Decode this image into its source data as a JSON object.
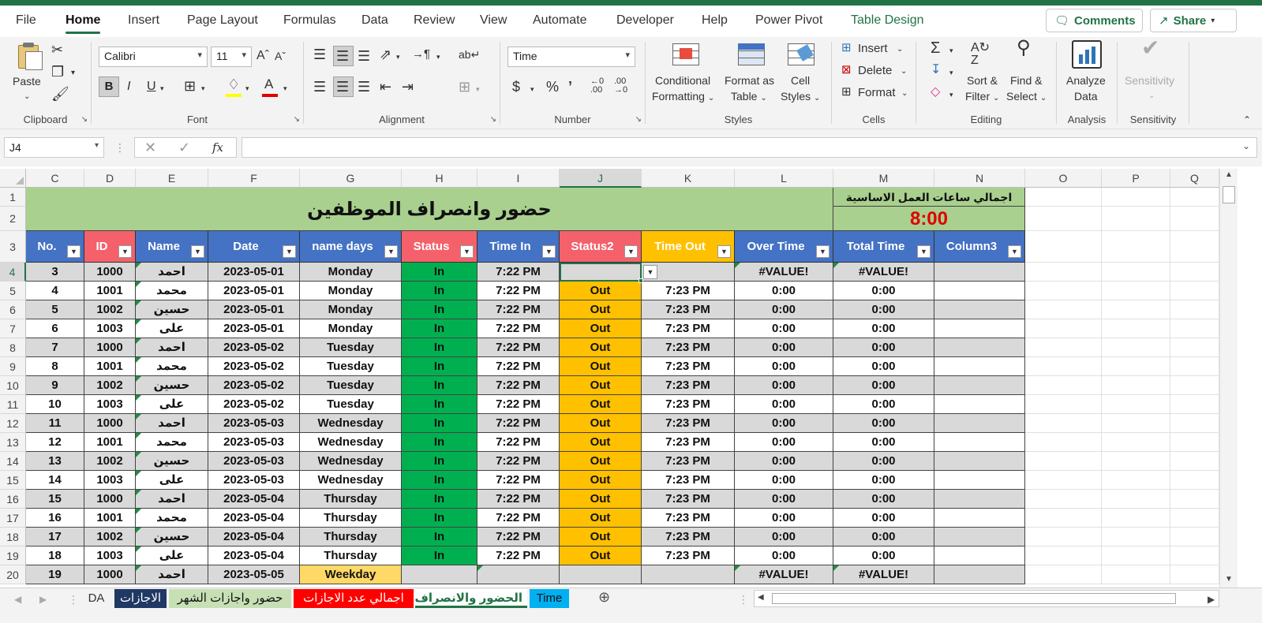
{
  "menu": {
    "tabs": [
      "File",
      "Home",
      "Insert",
      "Page Layout",
      "Formulas",
      "Data",
      "Review",
      "View",
      "Automate",
      "Developer",
      "Help",
      "Power Pivot",
      "Table Design"
    ],
    "comments": "Comments",
    "share": "Share"
  },
  "ribbon": {
    "clipboard": {
      "label": "Clipboard",
      "paste": "Paste"
    },
    "font": {
      "label": "Font",
      "name": "Calibri",
      "size": "11"
    },
    "alignment": {
      "label": "Alignment"
    },
    "number": {
      "label": "Number",
      "format": "Time"
    },
    "styles": {
      "label": "Styles",
      "conditional_1": "Conditional",
      "conditional_2": "Formatting",
      "format_table_1": "Format as",
      "format_table_2": "Table",
      "cell_styles_1": "Cell",
      "cell_styles_2": "Styles"
    },
    "cells": {
      "label": "Cells",
      "insert": "Insert",
      "delete": "Delete",
      "format": "Format"
    },
    "editing": {
      "label": "Editing",
      "sort_1": "Sort &",
      "sort_2": "Filter",
      "find_1": "Find &",
      "find_2": "Select"
    },
    "analysis": {
      "label": "Analysis",
      "analyze_1": "Analyze",
      "analyze_2": "Data"
    },
    "sensitivity": {
      "label": "Sensitivity",
      "btn": "Sensitivity"
    }
  },
  "formula_bar": {
    "name_box": "J4",
    "fx": "fx",
    "value": ""
  },
  "columns": [
    "C",
    "D",
    "E",
    "F",
    "G",
    "H",
    "I",
    "J",
    "K",
    "L",
    "M",
    "N",
    "O",
    "P",
    "Q"
  ],
  "rows": [
    "1",
    "2",
    "3",
    "4",
    "5",
    "6",
    "7",
    "8",
    "9",
    "10",
    "11",
    "12",
    "13",
    "14",
    "15",
    "16",
    "17",
    "18",
    "19",
    "20"
  ],
  "sheet": {
    "title": "حضور وانصراف الموظفين",
    "base_hours_label": "اجمالي ساعات العمل الاساسية",
    "base_hours_value": "8:00",
    "headers": [
      "No.",
      "ID",
      "Name",
      "Date",
      "name days",
      "Status",
      "Time In",
      "Status2",
      "Time Out",
      "Over Time",
      "Total Time",
      "Column3"
    ],
    "data": [
      [
        "3",
        "1000",
        "احمد",
        "2023-05-01",
        "Monday",
        "In",
        "7:22 PM",
        "",
        "",
        "#VALUE!",
        "#VALUE!",
        ""
      ],
      [
        "4",
        "1001",
        "محمد",
        "2023-05-01",
        "Monday",
        "In",
        "7:22 PM",
        "Out",
        "7:23 PM",
        "0:00",
        "0:00",
        ""
      ],
      [
        "5",
        "1002",
        "حسين",
        "2023-05-01",
        "Monday",
        "In",
        "7:22 PM",
        "Out",
        "7:23 PM",
        "0:00",
        "0:00",
        ""
      ],
      [
        "6",
        "1003",
        "على",
        "2023-05-01",
        "Monday",
        "In",
        "7:22 PM",
        "Out",
        "7:23 PM",
        "0:00",
        "0:00",
        ""
      ],
      [
        "7",
        "1000",
        "احمد",
        "2023-05-02",
        "Tuesday",
        "In",
        "7:22 PM",
        "Out",
        "7:23 PM",
        "0:00",
        "0:00",
        ""
      ],
      [
        "8",
        "1001",
        "محمد",
        "2023-05-02",
        "Tuesday",
        "In",
        "7:22 PM",
        "Out",
        "7:23 PM",
        "0:00",
        "0:00",
        ""
      ],
      [
        "9",
        "1002",
        "حسين",
        "2023-05-02",
        "Tuesday",
        "In",
        "7:22 PM",
        "Out",
        "7:23 PM",
        "0:00",
        "0:00",
        ""
      ],
      [
        "10",
        "1003",
        "على",
        "2023-05-02",
        "Tuesday",
        "In",
        "7:22 PM",
        "Out",
        "7:23 PM",
        "0:00",
        "0:00",
        ""
      ],
      [
        "11",
        "1000",
        "احمد",
        "2023-05-03",
        "Wednesday",
        "In",
        "7:22 PM",
        "Out",
        "7:23 PM",
        "0:00",
        "0:00",
        ""
      ],
      [
        "12",
        "1001",
        "محمد",
        "2023-05-03",
        "Wednesday",
        "In",
        "7:22 PM",
        "Out",
        "7:23 PM",
        "0:00",
        "0:00",
        ""
      ],
      [
        "13",
        "1002",
        "حسين",
        "2023-05-03",
        "Wednesday",
        "In",
        "7:22 PM",
        "Out",
        "7:23 PM",
        "0:00",
        "0:00",
        ""
      ],
      [
        "14",
        "1003",
        "على",
        "2023-05-03",
        "Wednesday",
        "In",
        "7:22 PM",
        "Out",
        "7:23 PM",
        "0:00",
        "0:00",
        ""
      ],
      [
        "15",
        "1000",
        "احمد",
        "2023-05-04",
        "Thursday",
        "In",
        "7:22 PM",
        "Out",
        "7:23 PM",
        "0:00",
        "0:00",
        ""
      ],
      [
        "16",
        "1001",
        "محمد",
        "2023-05-04",
        "Thursday",
        "In",
        "7:22 PM",
        "Out",
        "7:23 PM",
        "0:00",
        "0:00",
        ""
      ],
      [
        "17",
        "1002",
        "حسين",
        "2023-05-04",
        "Thursday",
        "In",
        "7:22 PM",
        "Out",
        "7:23 PM",
        "0:00",
        "0:00",
        ""
      ],
      [
        "18",
        "1003",
        "على",
        "2023-05-04",
        "Thursday",
        "In",
        "7:22 PM",
        "Out",
        "7:23 PM",
        "0:00",
        "0:00",
        ""
      ],
      [
        "19",
        "1000",
        "احمد",
        "2023-05-05",
        "Weekday",
        "",
        "",
        "",
        "",
        "#VALUE!",
        "#VALUE!",
        ""
      ]
    ]
  },
  "sheet_tabs": [
    "DA",
    "الاجازات",
    "حضور واجازات الشهر",
    "اجمالي عدد الاجازات",
    "الحضور والانصراف",
    "Time"
  ],
  "colors": {
    "excel_green": "#217346",
    "header_blue": "#4472c4",
    "header_red": "#f4616b",
    "header_orange": "#ffc000",
    "status_green": "#00b050",
    "out_yellow": "#ffc000",
    "title_green": "#a9d08e",
    "weekday_yellow": "#ffd966",
    "row_gray": "#d9d9d9",
    "value_red": "#e00000"
  }
}
